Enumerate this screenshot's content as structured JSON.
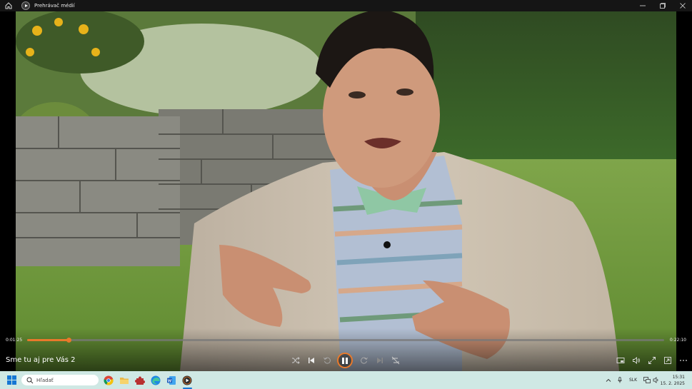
{
  "window": {
    "title": "Prehrávač médií",
    "app_icon": "media-player-icon",
    "buttons": [
      "minimize-icon",
      "maximize-icon",
      "close-icon"
    ]
  },
  "player": {
    "current_time": "0:01:25",
    "total_time": "0:22:10",
    "progress": 0.065,
    "video_title": "Sme tu aj pre Vás 2",
    "controls": [
      "shuffle-icon",
      "previous-icon",
      "rewind-10-icon",
      "pause-icon",
      "forward-30-icon",
      "next-icon",
      "repeat-off-icon",
      "miniplayer-icon",
      "volume-icon",
      "fullscreen-icon",
      "cast-icon",
      "more-icon"
    ]
  },
  "taskbar": {
    "search_placeholder": "Hľadať",
    "apps": [
      "chrome-icon",
      "file-explorer-icon",
      "puzzle-app-icon",
      "edge-icon",
      "word-icon",
      "media-player-icon"
    ],
    "language": "SLK",
    "time": "15:31",
    "date": "15. 2. 2025"
  },
  "colors": {
    "accent": "#e8792b",
    "taskbar": "#cfe8e4",
    "titlebar": "#151515"
  }
}
